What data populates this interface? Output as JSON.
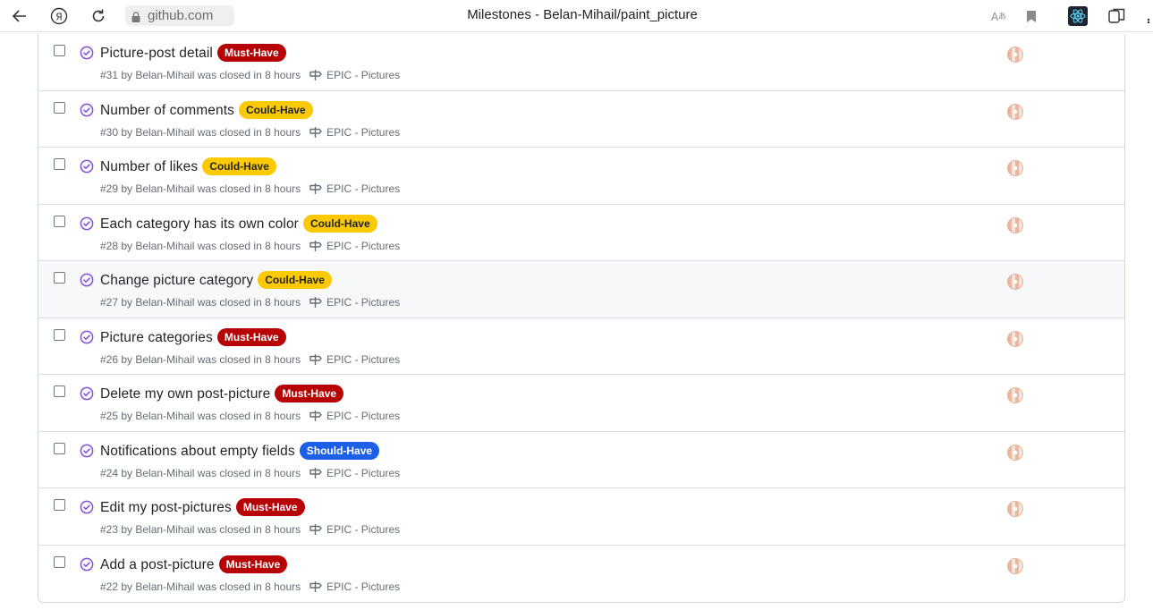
{
  "browser": {
    "url": "github.com",
    "page_title": "Milestones - Belan-Mihail/paint_picture"
  },
  "colors": {
    "must_have": "#b60205",
    "could_have": "#fbca04",
    "should_have": "#1d5fe8",
    "closed_icon": "#8250df"
  },
  "issues": [
    {
      "title": "Picture-post detail",
      "label": "Must-Have",
      "label_type": "must",
      "meta": "#31 by Belan-Mihail was closed in 8 hours",
      "milestone": "EPIC - Pictures"
    },
    {
      "title": "Number of comments",
      "label": "Could-Have",
      "label_type": "could",
      "meta": "#30 by Belan-Mihail was closed in 8 hours",
      "milestone": "EPIC - Pictures"
    },
    {
      "title": "Number of likes",
      "label": "Could-Have",
      "label_type": "could",
      "meta": "#29 by Belan-Mihail was closed in 8 hours",
      "milestone": "EPIC - Pictures"
    },
    {
      "title": "Each category has its own color",
      "label": "Could-Have",
      "label_type": "could",
      "meta": "#28 by Belan-Mihail was closed in 8 hours",
      "milestone": "EPIC - Pictures"
    },
    {
      "title": "Change picture category",
      "label": "Could-Have",
      "label_type": "could",
      "meta": "#27 by Belan-Mihail was closed in 8 hours",
      "milestone": "EPIC - Pictures"
    },
    {
      "title": "Picture categories",
      "label": "Must-Have",
      "label_type": "must",
      "meta": "#26 by Belan-Mihail was closed in 8 hours",
      "milestone": "EPIC - Pictures"
    },
    {
      "title": "Delete my own post-picture",
      "label": "Must-Have",
      "label_type": "must",
      "meta": "#25 by Belan-Mihail was closed in 8 hours",
      "milestone": "EPIC - Pictures"
    },
    {
      "title": "Notifications about empty fields",
      "label": "Should-Have",
      "label_type": "should",
      "meta": "#24 by Belan-Mihail was closed in 8 hours",
      "milestone": "EPIC - Pictures"
    },
    {
      "title": "Edit my post-pictures",
      "label": "Must-Have",
      "label_type": "must",
      "meta": "#23 by Belan-Mihail was closed in 8 hours",
      "milestone": "EPIC - Pictures"
    },
    {
      "title": "Add a post-picture",
      "label": "Must-Have",
      "label_type": "must",
      "meta": "#22 by Belan-Mihail was closed in 8 hours",
      "milestone": "EPIC - Pictures"
    }
  ]
}
